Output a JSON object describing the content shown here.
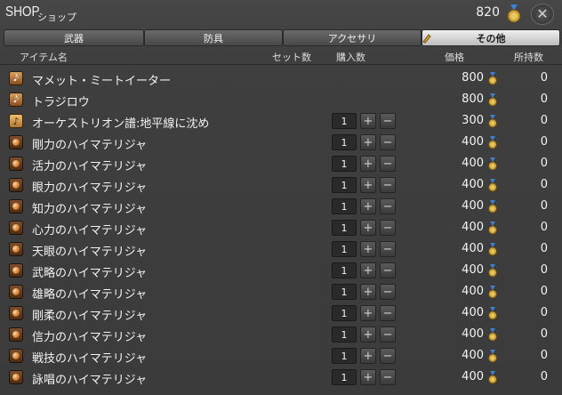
{
  "header": {
    "title": "SHOP",
    "subtitle": "ショップ",
    "gil": "820"
  },
  "tabs": [
    {
      "label": "武器",
      "active": false
    },
    {
      "label": "防具",
      "active": false
    },
    {
      "label": "アクセサリ",
      "active": false
    },
    {
      "label": "その他",
      "active": true
    }
  ],
  "columns": {
    "item": "アイテム名",
    "sets": "セット数",
    "buy": "購入数",
    "price": "価格",
    "owned": "所持数"
  },
  "items": [
    {
      "icon": "music-icon",
      "name": "マメット・ミートイーター",
      "qty": null,
      "price": "800",
      "owned": "0"
    },
    {
      "icon": "music-icon",
      "name": "トラジロウ",
      "qty": null,
      "price": "800",
      "owned": "0"
    },
    {
      "icon": "note-icon",
      "name": "オーケストリオン譜:地平線に沈め",
      "qty": "1",
      "price": "300",
      "owned": "0"
    },
    {
      "icon": "materia-icon",
      "name": "剛力のハイマテリジャ",
      "qty": "1",
      "price": "400",
      "owned": "0"
    },
    {
      "icon": "materia-icon",
      "name": "活力のハイマテリジャ",
      "qty": "1",
      "price": "400",
      "owned": "0"
    },
    {
      "icon": "materia-icon",
      "name": "眼力のハイマテリジャ",
      "qty": "1",
      "price": "400",
      "owned": "0"
    },
    {
      "icon": "materia-icon",
      "name": "知力のハイマテリジャ",
      "qty": "1",
      "price": "400",
      "owned": "0"
    },
    {
      "icon": "materia-icon",
      "name": "心力のハイマテリジャ",
      "qty": "1",
      "price": "400",
      "owned": "0"
    },
    {
      "icon": "materia-icon",
      "name": "天眼のハイマテリジャ",
      "qty": "1",
      "price": "400",
      "owned": "0"
    },
    {
      "icon": "materia-icon",
      "name": "武略のハイマテリジャ",
      "qty": "1",
      "price": "400",
      "owned": "0"
    },
    {
      "icon": "materia-icon",
      "name": "雄略のハイマテリジャ",
      "qty": "1",
      "price": "400",
      "owned": "0"
    },
    {
      "icon": "materia-icon",
      "name": "剛柔のハイマテリジャ",
      "qty": "1",
      "price": "400",
      "owned": "0"
    },
    {
      "icon": "materia-icon",
      "name": "信力のハイマテリジャ",
      "qty": "1",
      "price": "400",
      "owned": "0"
    },
    {
      "icon": "materia-icon",
      "name": "戦技のハイマテリジャ",
      "qty": "1",
      "price": "400",
      "owned": "0"
    },
    {
      "icon": "materia-icon",
      "name": "詠唱のハイマテリジャ",
      "qty": "1",
      "price": "400",
      "owned": "0"
    }
  ],
  "stepper": {
    "plus": "+",
    "minus": "−"
  }
}
